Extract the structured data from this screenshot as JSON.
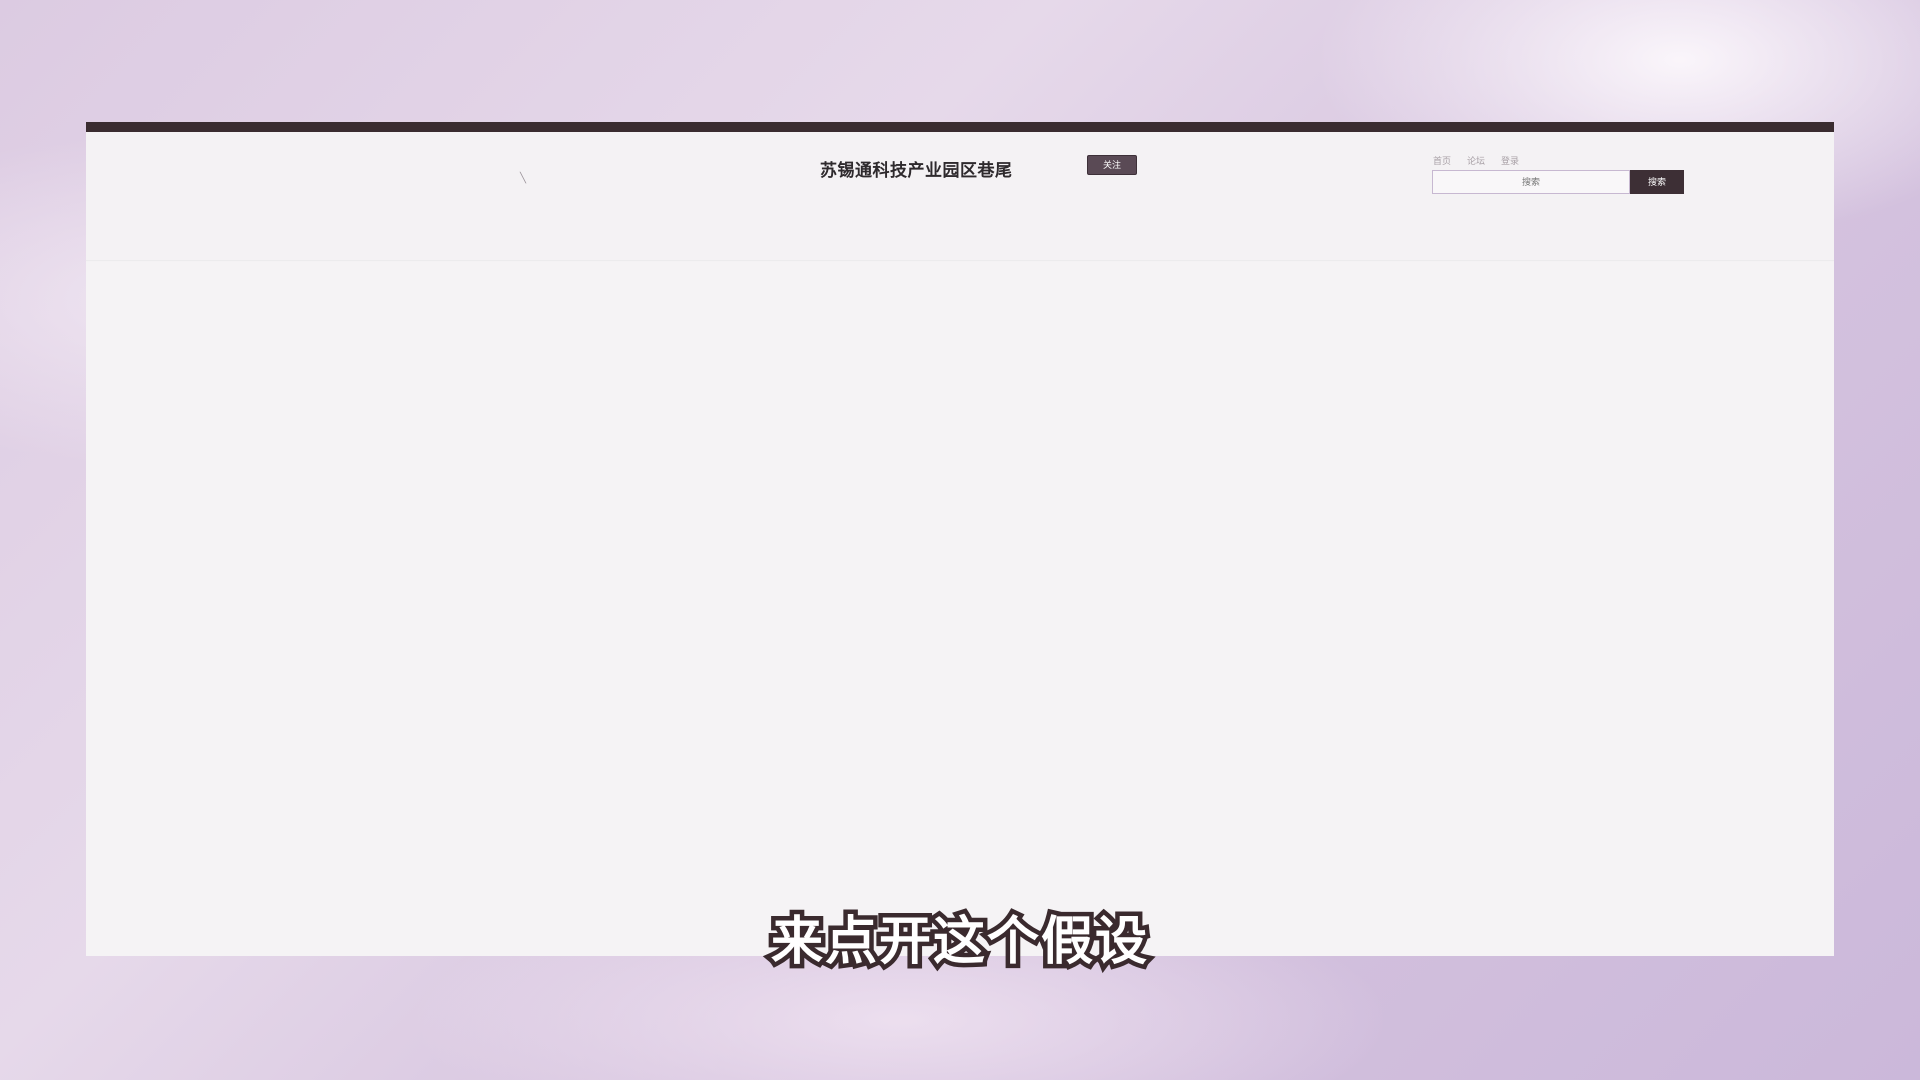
{
  "header": {
    "site_title": "苏锡通科技产业园区巷尾",
    "follow_label": "关注",
    "links": [
      "首页",
      "论坛",
      "登录"
    ],
    "search_placeholder": "搜索",
    "search_button_label": "搜索"
  },
  "subtitle": "来点开这个假设",
  "colors": {
    "top_strip": "#3a2c30",
    "follow_button": "#5a4a55",
    "search_button": "#3d2f35",
    "page_background": "#f4f2f4"
  }
}
